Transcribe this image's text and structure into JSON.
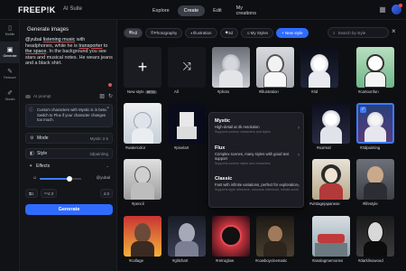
{
  "app": {
    "logo": "FREEP!K",
    "suite": "AI Suite"
  },
  "nav": {
    "tabs": [
      {
        "label": "Explore"
      },
      {
        "label": "Create"
      },
      {
        "label": "Edit"
      },
      {
        "label": "My creations"
      }
    ],
    "active": "Create"
  },
  "rail": {
    "items": [
      {
        "label": "Mobile",
        "icon": "mobile-icon"
      },
      {
        "label": "Generate",
        "icon": "image-icon"
      },
      {
        "label": "Retouch",
        "icon": "brush-icon"
      },
      {
        "label": "Sketch",
        "icon": "pencil-icon"
      }
    ]
  },
  "panel": {
    "title": "Generate images",
    "prompt": {
      "seg1": "@yubal ",
      "seg2": "listening music",
      "seg3": " with headphones, while he is ",
      "seg4": "transporter",
      "seg5": " to ",
      "seg6": "the space",
      "seg7": ". In the background you see stars and musical notes. He wears jeans and a black shirt."
    },
    "ai_prompt_label": "AI prompt",
    "info": "Custom characters with Mystic is in beta. Switch to Flux if your character changes too much.",
    "mode_label": "Mode",
    "mode_value": "Mystic 2.5",
    "style_label": "Style",
    "style_value": "3dpainting",
    "effects_label": "Effects",
    "slider_value": "@yubal",
    "count_1": "1",
    "count_2": "4:3",
    "count_3": "4.0",
    "generate_label": "Generate"
  },
  "filters": {
    "items": [
      {
        "label": "All"
      },
      {
        "label": "Photography"
      },
      {
        "label": "Illustration"
      },
      {
        "label": "3d"
      },
      {
        "label": "My Styles"
      }
    ],
    "new_style": "+ New style",
    "search_placeholder": "Search by style"
  },
  "grid": {
    "row1": [
      {
        "label": "New style",
        "badge": "BETA"
      },
      {
        "label": "All"
      },
      {
        "label": "#photo"
      },
      {
        "label": "#illustration"
      },
      {
        "label": "#3d"
      },
      {
        "label": "#cartoonfun"
      }
    ],
    "row2": [
      {
        "label": "#watercolor"
      },
      {
        "label": "#pixelart"
      },
      {
        "label": "#surreal"
      },
      {
        "label": "#3dpainting"
      }
    ],
    "row3": [
      {
        "label": "#pencil"
      },
      {
        "label": "#retrowave"
      },
      {
        "label": "#vintagejapanese"
      },
      {
        "label": "#lifestyle"
      }
    ],
    "row4": [
      {
        "label": "#collage"
      },
      {
        "label": "#glitchart"
      },
      {
        "label": "#retroglow"
      },
      {
        "label": "#cowboycinematic"
      },
      {
        "label": "#analogmemories"
      },
      {
        "label": "#darklinowood"
      }
    ]
  },
  "popover": {
    "items": [
      {
        "title": "Mystic",
        "desc": "High-detail at 2k resolution",
        "sub": "Supports custom characters and styles"
      },
      {
        "title": "Flux",
        "desc": "Complex scenes, many styles with good text support",
        "sub": "Supports custom styles and characters"
      },
      {
        "title": "Classic",
        "desc": "Fast with infinite variations, perfect for exploration",
        "sub": "Supports style reference, structure reference, infinite scroll"
      }
    ]
  },
  "colors": {
    "accent": "#2f6bff",
    "bg": "#0e0f12",
    "panel": "#131519"
  }
}
